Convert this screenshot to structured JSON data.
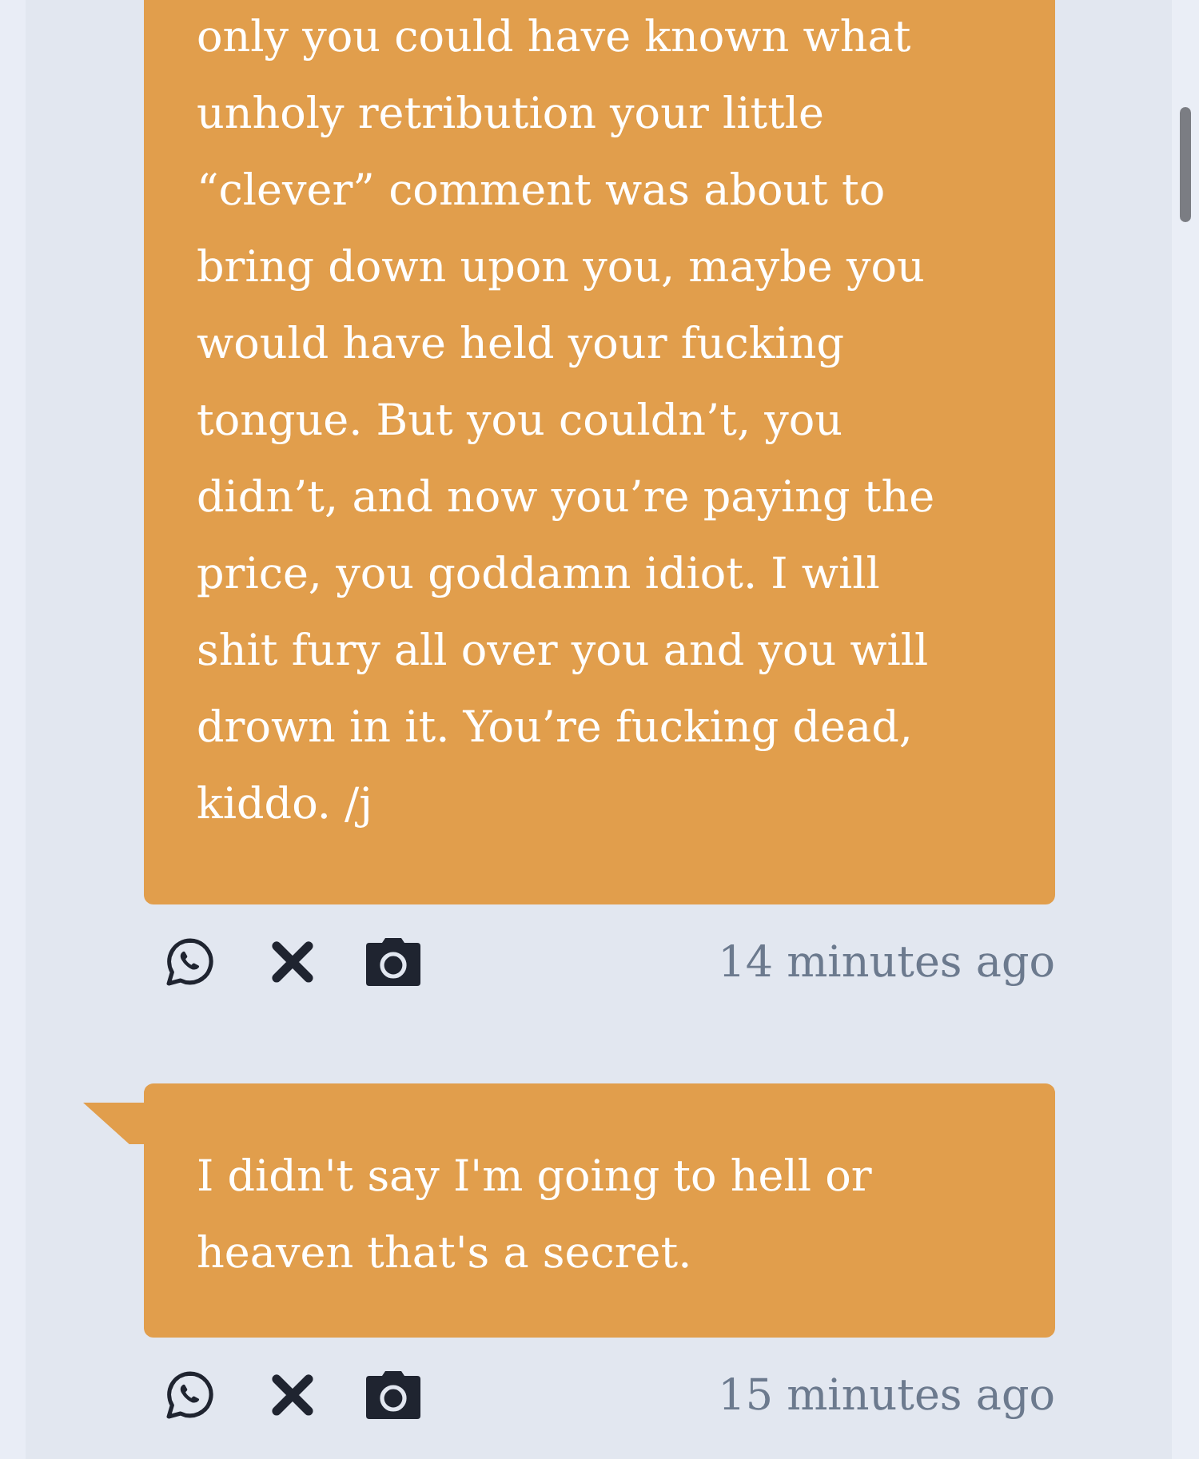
{
  "messages": [
    {
      "text": "only you could have known what\nunholy retribution your little\n“clever” comment was about to\nbring down upon you, maybe you\nwould have held your fucking\ntongue. But you couldn’t, you\ndidn’t, and now you’re paying the\nprice, you goddamn idiot. I will\nshit fury all over you and you will\ndrown in it. You’re fucking dead,\nkiddo. /j",
      "time": "14 minutes ago",
      "tail": false
    },
    {
      "text": "I didn't say I'm going to hell or\nheaven that's a secret.",
      "time": "15 minutes ago",
      "tail": true
    }
  ]
}
